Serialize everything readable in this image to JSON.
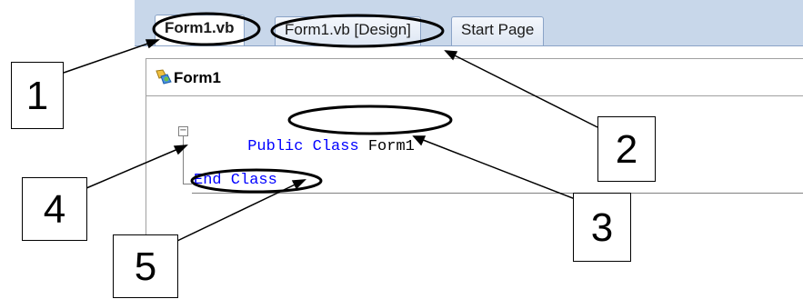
{
  "tabs": [
    {
      "label": "Form1.vb",
      "active": true
    },
    {
      "label": "Form1.vb [Design]",
      "active": false
    },
    {
      "label": "Start Page",
      "active": false
    }
  ],
  "editor": {
    "class_selector": "Form1",
    "code": {
      "public_kw": "Public",
      "class_kw": "Class",
      "class_name": "Form1",
      "end_class": "End Class",
      "collapse_glyph": "−"
    }
  },
  "callouts": [
    "1",
    "2",
    "3",
    "4",
    "5"
  ],
  "colors": {
    "keyword": "#0000ff",
    "tabstrip": "#c8d7ea",
    "outline": "#808080"
  }
}
